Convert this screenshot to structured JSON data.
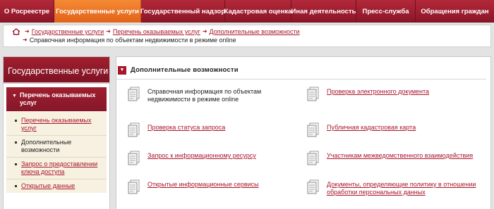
{
  "topnav": {
    "items": [
      {
        "label": "О Росреестре"
      },
      {
        "label": "Государственные услуги"
      },
      {
        "label": "Государственный надзор"
      },
      {
        "label": "Кадастровая оценка"
      },
      {
        "label": "Иная деятельность"
      },
      {
        "label": "Пресс-служба"
      },
      {
        "label": "Обращения граждан"
      }
    ]
  },
  "breadcrumb": {
    "links": [
      "Государственные услуги",
      "Перечень оказываемых услуг",
      "Дополнительные возможности"
    ],
    "current": "Справочная информация по объектам недвижимости в режиме online"
  },
  "sidebar": {
    "title": "Государственные услуги",
    "active_section": "Перечень оказываемых услуг",
    "items": [
      {
        "label": "Перечень оказываемых услуг"
      },
      {
        "label": "Дополнительные возможности"
      },
      {
        "label": "Запрос о предоставлении ключа доступа"
      },
      {
        "label": "Открытые данные"
      }
    ]
  },
  "main": {
    "title": "Дополнительные возможности",
    "left": [
      {
        "label": "Справочная информация по объектам недвижимости в режиме online"
      },
      {
        "label": "Проверка статуса запроса"
      },
      {
        "label": "Запрос к информационному ресурсу"
      },
      {
        "label": "Открытые информационные сервисы"
      }
    ],
    "right": [
      {
        "label": "Проверка электронного документа"
      },
      {
        "label": "Публичная кадастровая карта"
      },
      {
        "label": "Участникам межведомственного взаимодействия"
      },
      {
        "label": "Документы, определяющие политику в отношении обработки персональных данных"
      }
    ]
  }
}
